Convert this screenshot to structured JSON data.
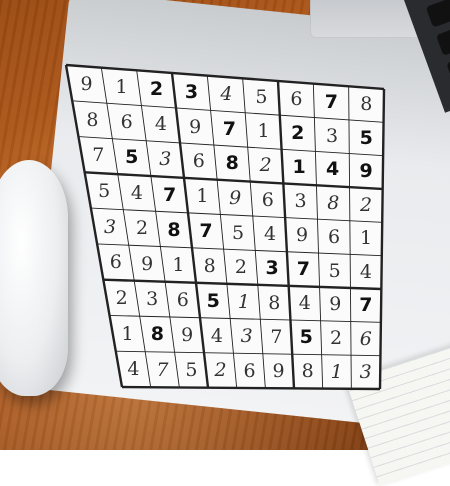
{
  "sudoku": {
    "rows": [
      [
        "9",
        "1",
        "2",
        "3",
        "4",
        "5",
        "6",
        "7",
        "8"
      ],
      [
        "8",
        "6",
        "4",
        "9",
        "7",
        "1",
        "2",
        "3",
        "5"
      ],
      [
        "7",
        "5",
        "3",
        "6",
        "8",
        "2",
        "1",
        "4",
        "9"
      ],
      [
        "5",
        "4",
        "7",
        "1",
        "9",
        "6",
        "3",
        "8",
        "2"
      ],
      [
        "3",
        "2",
        "8",
        "7",
        "5",
        "4",
        "9",
        "6",
        "1"
      ],
      [
        "6",
        "9",
        "1",
        "8",
        "2",
        "3",
        "7",
        "5",
        "4"
      ],
      [
        "2",
        "3",
        "6",
        "5",
        "1",
        "8",
        "4",
        "9",
        "7"
      ],
      [
        "1",
        "8",
        "9",
        "4",
        "3",
        "7",
        "5",
        "2",
        "6"
      ],
      [
        "4",
        "7",
        "5",
        "2",
        "6",
        "9",
        "8",
        "1",
        "3"
      ]
    ]
  }
}
